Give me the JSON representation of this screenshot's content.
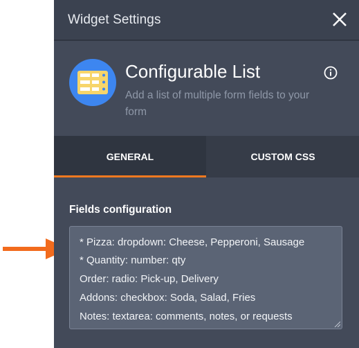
{
  "dialog": {
    "title": "Widget Settings",
    "icons": {
      "close": "close-icon",
      "info": "info-icon",
      "widget": "configurable-list-icon"
    }
  },
  "widget": {
    "name": "Configurable List",
    "description": "Add a list of multiple form fields to your form"
  },
  "tabs": [
    {
      "label": "GENERAL",
      "active": true
    },
    {
      "label": "CUSTOM CSS",
      "active": false
    }
  ],
  "fields_configuration": {
    "label": "Fields configuration",
    "lines": [
      "*  Pizza: dropdown: Cheese, Pepperoni, Sausage",
      "*  Quantity: number: qty",
      "Order: radio: Pick-up, Delivery",
      "Addons: checkbox: Soda, Salad, Fries",
      "Notes: textarea: comments, notes, or requests"
    ]
  },
  "colors": {
    "panel_bg": "#434a59",
    "tab_active_indicator": "#f5791f",
    "annotation_arrow": "#f26b1d",
    "widget_icon_bg": "#3d86f0"
  }
}
